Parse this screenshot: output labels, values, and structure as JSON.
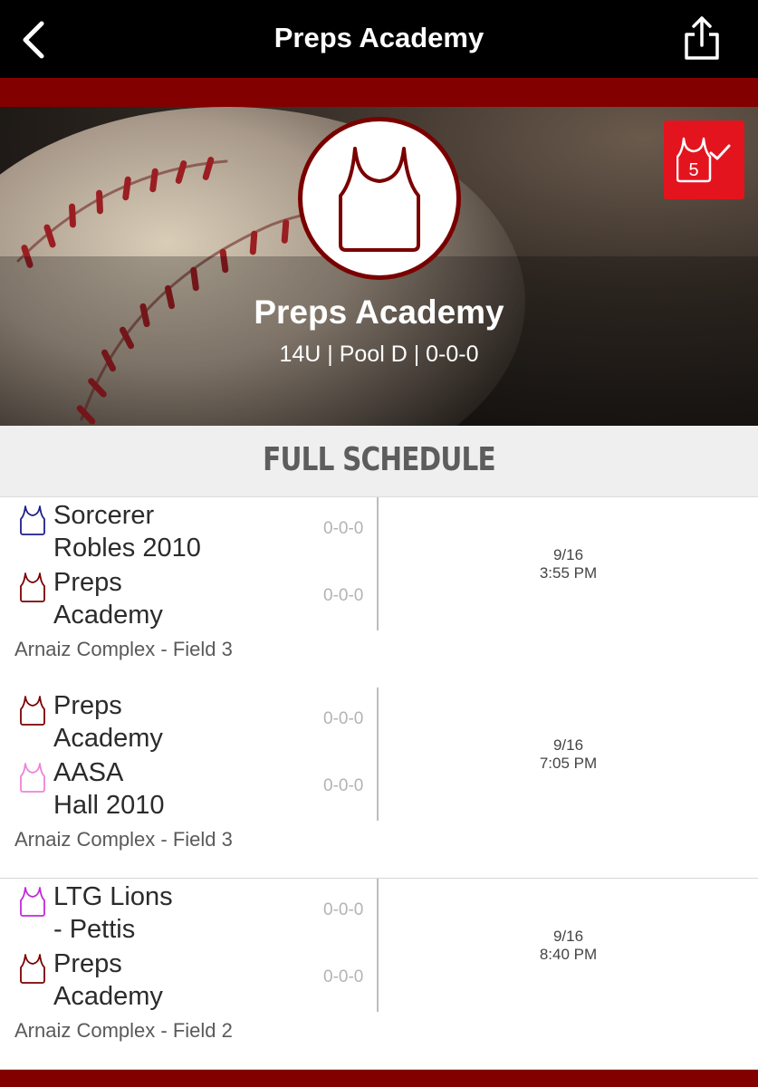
{
  "nav": {
    "title": "Preps Academy",
    "back_icon": "chevron-left-icon",
    "share_icon": "share-icon"
  },
  "colors": {
    "navbar": "#000000",
    "accent": "#820000",
    "badge": "#e4141f",
    "team_primary": "#7a0000"
  },
  "hero": {
    "team_name": "Preps Academy",
    "subtitle": "14U | Pool D | 0-0-0",
    "logo_icon": "jersey-icon",
    "badge": {
      "icon": "jersey-check-icon",
      "number": "5"
    }
  },
  "schedule": {
    "title": "FULL SCHEDULE",
    "games": [
      {
        "teams": [
          {
            "name_line1": "Sorcerer",
            "name_line2": "Robles 2010",
            "record": "0-0-0",
            "jersey_color": "#1e1e8c"
          },
          {
            "name_line1": "Preps",
            "name_line2": "Academy",
            "record": "0-0-0",
            "jersey_color": "#7a0000"
          }
        ],
        "date": "9/16",
        "time": "3:55 PM",
        "venue": "Arnaiz Complex - Field 3"
      },
      {
        "teams": [
          {
            "name_line1": "Preps",
            "name_line2": "Academy",
            "record": "0-0-0",
            "jersey_color": "#7a0000"
          },
          {
            "name_line1": "AASA",
            "name_line2": "Hall 2010",
            "record": "0-0-0",
            "jersey_color": "#ee82d8"
          }
        ],
        "date": "9/16",
        "time": "7:05 PM",
        "venue": "Arnaiz Complex - Field 3"
      },
      {
        "teams": [
          {
            "name_line1": "LTG Lions",
            "name_line2": "- Pettis",
            "record": "0-0-0",
            "jersey_color": "#c02ad6"
          },
          {
            "name_line1": "Preps",
            "name_line2": "Academy",
            "record": "0-0-0",
            "jersey_color": "#7a0000"
          }
        ],
        "date": "9/16",
        "time": "8:40 PM",
        "venue": "Arnaiz Complex - Field 2"
      }
    ]
  }
}
